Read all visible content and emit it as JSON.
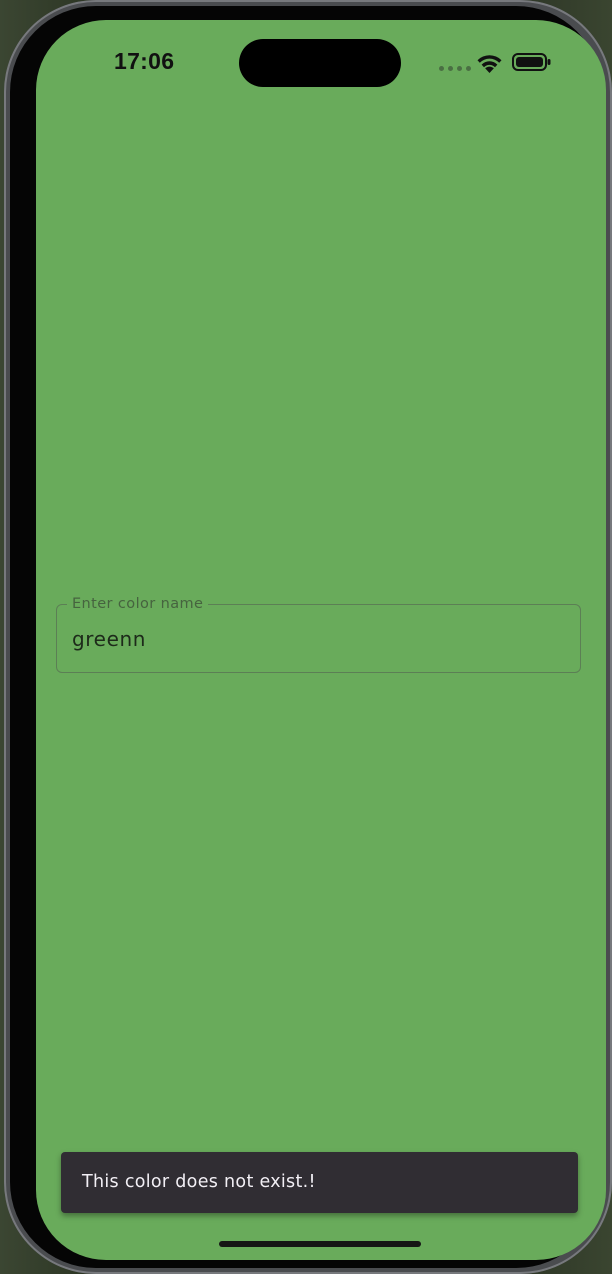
{
  "status_bar": {
    "time": "17:06",
    "icons": [
      "signal-dots-icon",
      "wifi-icon",
      "battery-icon"
    ]
  },
  "screen": {
    "background_color": "#69ab5b"
  },
  "color_input": {
    "label": "Enter color name",
    "value": "greenn"
  },
  "snackbar": {
    "message": "This color does not exist.!",
    "background_color": "#302d33"
  }
}
